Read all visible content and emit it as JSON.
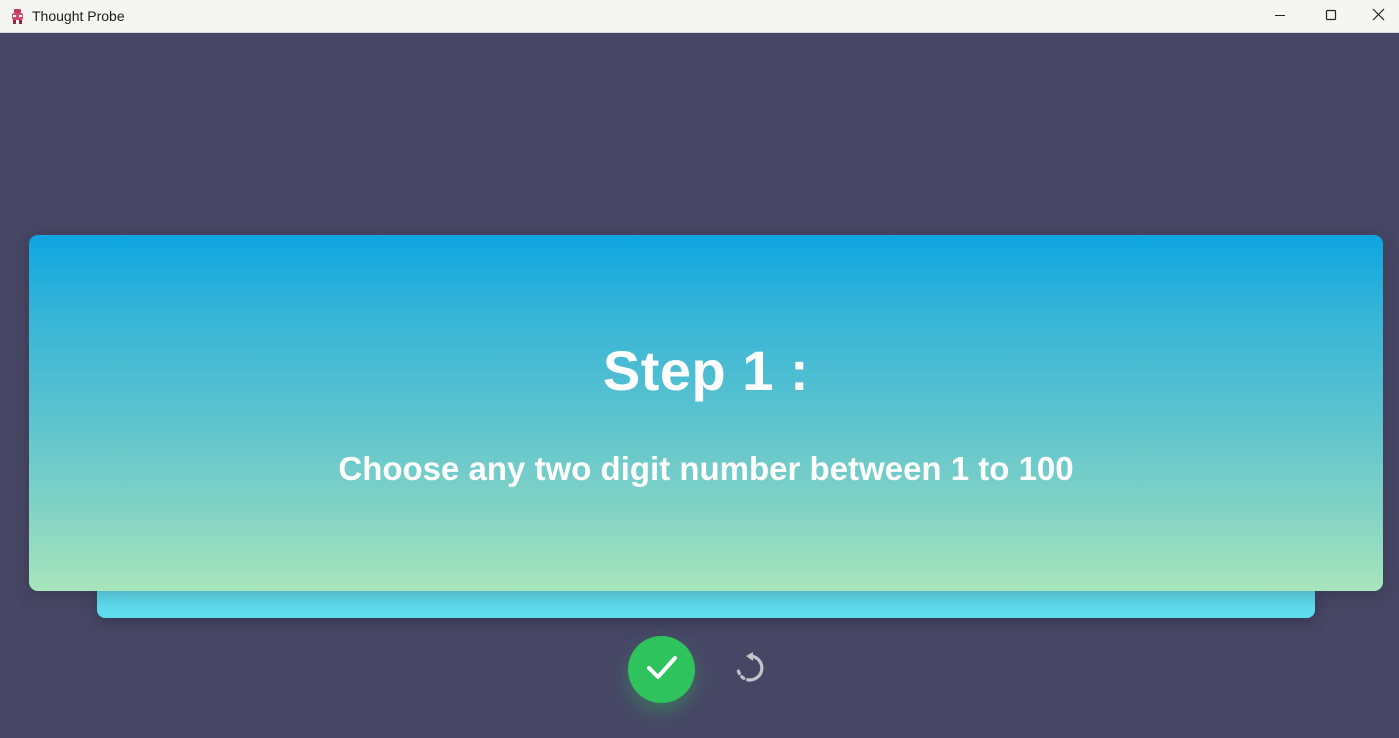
{
  "window": {
    "title": "Thought Probe",
    "app_icon": "app-icon",
    "controls": {
      "minimize_icon": "minimize-icon",
      "maximize_icon": "maximize-icon",
      "close_icon": "close-icon"
    }
  },
  "card": {
    "title": "Step 1 :",
    "instruction": "Choose any two digit number between 1 to 100"
  },
  "actions": {
    "confirm_icon": "check-icon",
    "reset_icon": "refresh-icon"
  },
  "colors": {
    "background": "#474765",
    "card_gradient_top": "#0ea5e0",
    "card_gradient_bottom": "#a8e5bc",
    "card_back": "#5fdded",
    "confirm_button": "#2fc35d",
    "reset_icon": "#b9b9c4"
  }
}
